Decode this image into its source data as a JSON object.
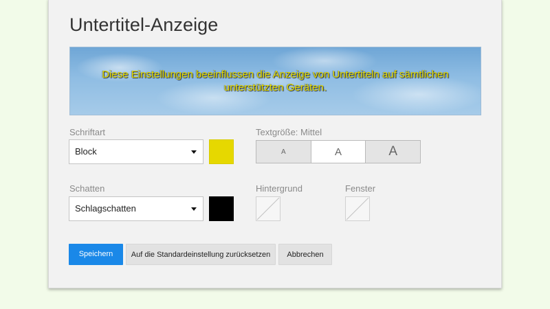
{
  "dialog": {
    "title": "Untertitel-Anzeige",
    "preview_text": "Diese Einstellungen beeinflussen die Anzeige von Untertiteln auf sämtlichen unterstützten Geräten."
  },
  "font": {
    "label": "Schriftart",
    "value": "Block",
    "color": "#e6d800"
  },
  "text_size": {
    "label": "Textgröße: Mittel",
    "options": [
      "A",
      "A",
      "A"
    ],
    "selected_index": 1
  },
  "shadow": {
    "label": "Schatten",
    "value": "Schlagschatten",
    "color": "#000000"
  },
  "background": {
    "label": "Hintergrund"
  },
  "window": {
    "label": "Fenster"
  },
  "buttons": {
    "save": "Speichern",
    "reset": "Auf die Standardeinstellung zurücksetzen",
    "cancel": "Abbrechen"
  },
  "colors": {
    "accent": "#1a88e8",
    "page_background": "#f2fbe9",
    "panel_background": "#f2f2f2",
    "preview_text": "#e6dd00"
  },
  "icons": {
    "dropdown": "chevron-down-icon",
    "empty_color": "no-color-icon"
  }
}
